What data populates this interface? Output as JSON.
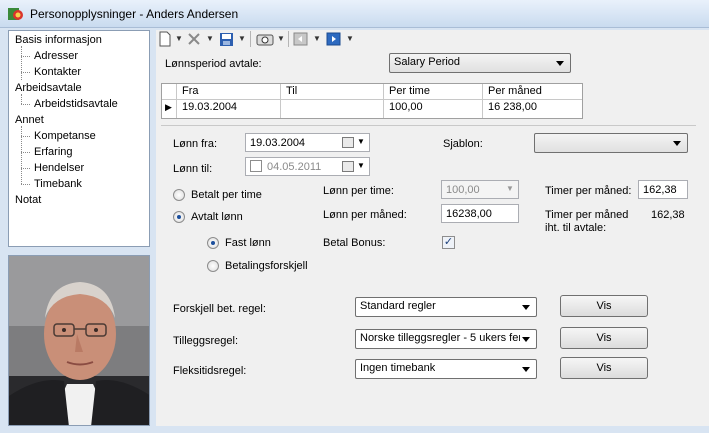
{
  "window": {
    "title": "Personopplysninger - Anders Andersen"
  },
  "tree": {
    "items": [
      {
        "label": "Basis informasjon",
        "level": 0
      },
      {
        "label": "Adresser",
        "level": 1
      },
      {
        "label": "Kontakter",
        "level": 1
      },
      {
        "label": "Arbeidsavtale",
        "level": 0
      },
      {
        "label": "Arbeidstidsavtale",
        "level": 1
      },
      {
        "label": "Annet",
        "level": 0
      },
      {
        "label": "Kompetanse",
        "level": 1
      },
      {
        "label": "Erfaring",
        "level": 1
      },
      {
        "label": "Hendelser",
        "level": 1
      },
      {
        "label": "Timebank",
        "level": 1
      },
      {
        "label": "Notat",
        "level": 0
      }
    ]
  },
  "toolbar": {
    "icons": [
      "new-document-icon",
      "delete-icon",
      "save-icon",
      "camera-icon",
      "previous-icon",
      "next-icon"
    ]
  },
  "period": {
    "label": "Lønnsperiod avtale:",
    "value": "Salary Period"
  },
  "grid": {
    "columns": [
      "Fra",
      "Til",
      "Per time",
      "Per måned"
    ],
    "rows": [
      {
        "fra": "19.03.2004",
        "til": "",
        "per_time": "100,00",
        "per_maned": "16 238,00"
      }
    ]
  },
  "form": {
    "lonn_fra_label": "Lønn fra:",
    "lonn_fra_value": "19.03.2004",
    "lonn_til_label": "Lønn til:",
    "lonn_til_value": "04.05.2011",
    "sjablon_label": "Sjablon:",
    "sjablon_value": "",
    "betalt_per_time_label": "Betalt per time",
    "avtalt_lonn_label": "Avtalt lønn",
    "fast_lonn_label": "Fast lønn",
    "betalingsforskjell_label": "Betalingsforskjell",
    "lonn_per_time_label": "Lønn per time:",
    "lonn_per_time_value": "100,00",
    "lonn_per_maned_label": "Lønn per måned:",
    "lonn_per_maned_value": "16238,00",
    "betal_bonus_label": "Betal Bonus:",
    "betal_bonus_checked": true,
    "timer_per_maned_label": "Timer per måned:",
    "timer_per_maned_value": "162,38",
    "timer_avtale_label_1": "Timer per måned",
    "timer_avtale_label_2": "iht. til avtale:",
    "timer_avtale_value": "162,38",
    "forskjell_label": "Forskjell bet. regel:",
    "forskjell_value": "Standard regler",
    "tillegg_label": "Tilleggsregel:",
    "tillegg_value": "Norske tilleggsregler -  5 ukers fer",
    "fleks_label": "Fleksitidsregel:",
    "fleks_value": "Ingen timebank",
    "vis_label": "Vis"
  }
}
